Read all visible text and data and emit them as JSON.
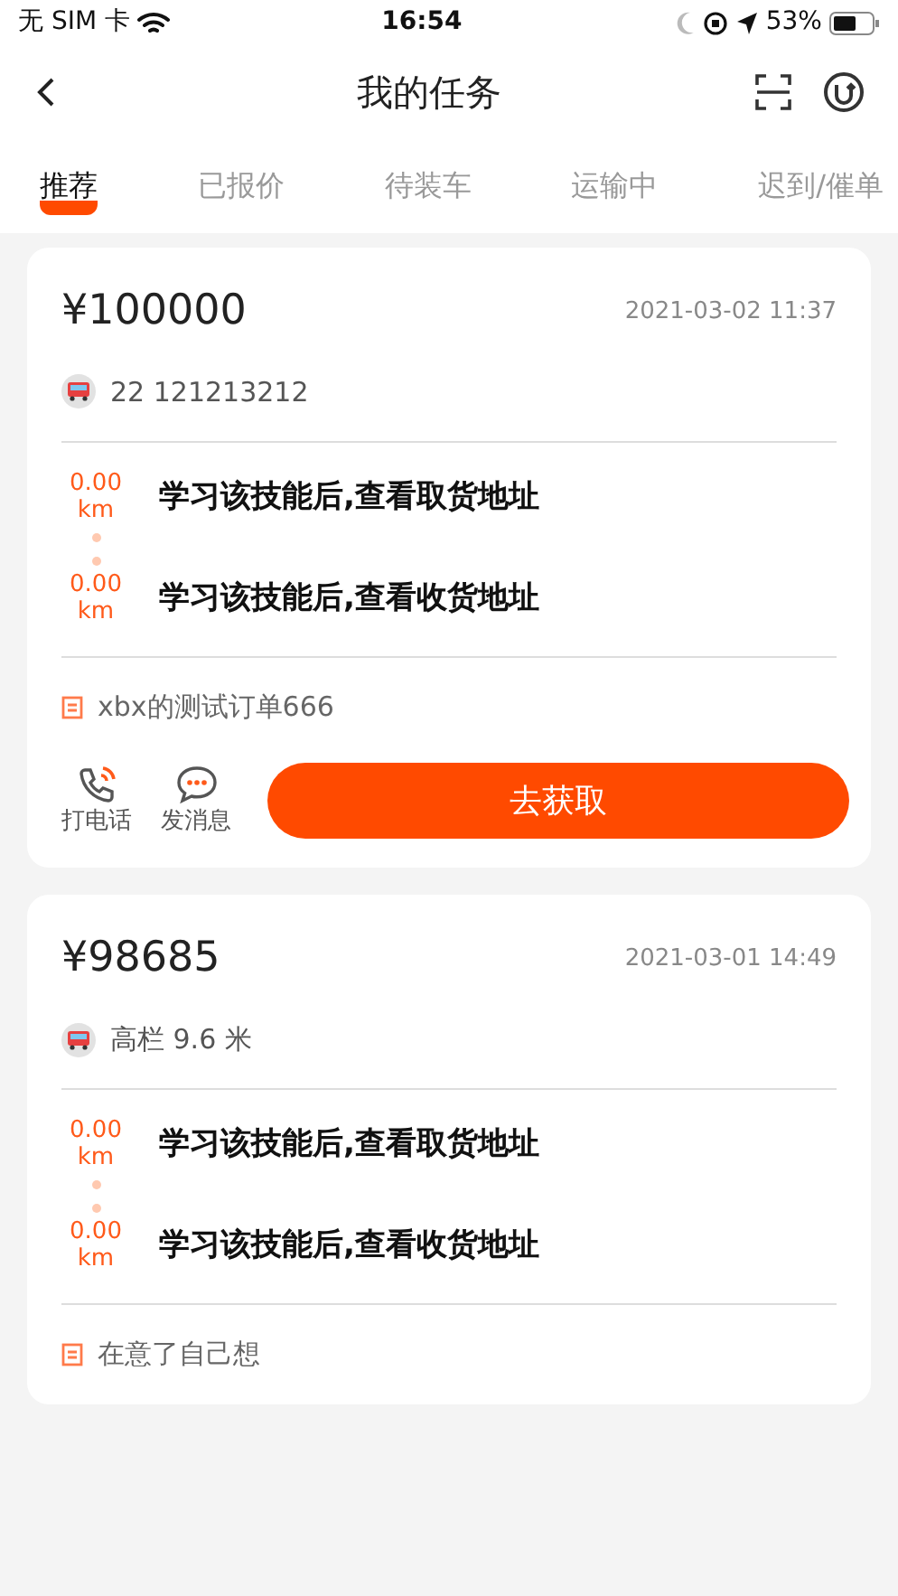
{
  "status_bar": {
    "carrier": "无 SIM 卡",
    "time": "16:54",
    "battery": "53%"
  },
  "nav": {
    "title": "我的任务"
  },
  "tabs": [
    {
      "label": "推荐",
      "selected": true
    },
    {
      "label": "已报价",
      "selected": false
    },
    {
      "label": "待装车",
      "selected": false
    },
    {
      "label": "运输中",
      "selected": false
    },
    {
      "label": "迟到/催单",
      "selected": false
    }
  ],
  "orders": [
    {
      "price": "¥100000",
      "date": "2021-03-02 11:37",
      "vehicle": "22 121213212",
      "stops": [
        {
          "distance": "0.00",
          "unit": "km",
          "address": "学习该技能后,查看取货地址"
        },
        {
          "distance": "0.00",
          "unit": "km",
          "address": "学习该技能后,查看收货地址"
        }
      ],
      "note": "xbx的测试订单666",
      "actions": {
        "call": "打电话",
        "message": "发消息",
        "primary": "去获取"
      }
    },
    {
      "price": "¥98685",
      "date": "2021-03-01 14:49",
      "vehicle": "高栏 9.6 米",
      "stops": [
        {
          "distance": "0.00",
          "unit": "km",
          "address": "学习该技能后,查看取货地址"
        },
        {
          "distance": "0.00",
          "unit": "km",
          "address": "学习该技能后,查看收货地址"
        }
      ],
      "note": "在意了自己想"
    }
  ]
}
